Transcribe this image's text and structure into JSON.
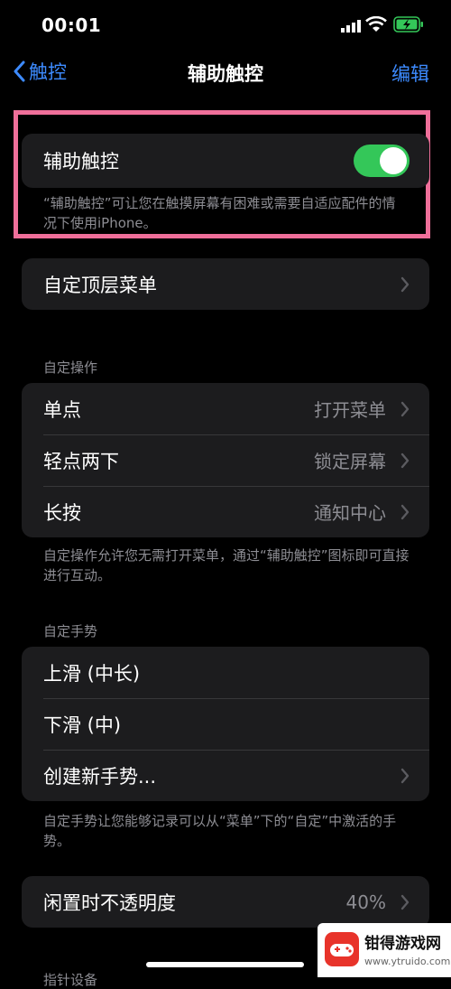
{
  "status_bar": {
    "time": "00:01"
  },
  "nav": {
    "back_label": "触控",
    "title": "辅助触控",
    "edit_label": "编辑"
  },
  "assistive": {
    "label": "辅助触控",
    "enabled": true,
    "description": "“辅助触控”可让您在触摸屏幕有困难或需要自适应配件的情况下使用iPhone。"
  },
  "top_menu": {
    "label": "自定顶层菜单"
  },
  "custom_actions": {
    "header": "自定操作",
    "rows": [
      {
        "label": "单点",
        "value": "打开菜单"
      },
      {
        "label": "轻点两下",
        "value": "锁定屏幕"
      },
      {
        "label": "长按",
        "value": "通知中心"
      }
    ],
    "footer": "自定操作允许您无需打开菜单，通过“辅助触控”图标即可直接进行互动。"
  },
  "custom_gestures": {
    "header": "自定手势",
    "rows": [
      {
        "label": "上滑 (中长)"
      },
      {
        "label": "下滑 (中)"
      },
      {
        "label": "创建新手势..."
      }
    ],
    "footer": "自定手势让您能够记录可以从“菜单”下的“自定”中激活的手势。"
  },
  "idle_opacity": {
    "label": "闲置时不透明度",
    "value": "40%"
  },
  "partial_header": "指针设备",
  "watermark": {
    "name": "钳得游戏网",
    "url": "www.ytruido.com"
  },
  "colors": {
    "accent": "#3d8bff",
    "toggle_on": "#34c759",
    "highlight": "#ef6f9a",
    "group_bg": "#1c1c1e"
  }
}
